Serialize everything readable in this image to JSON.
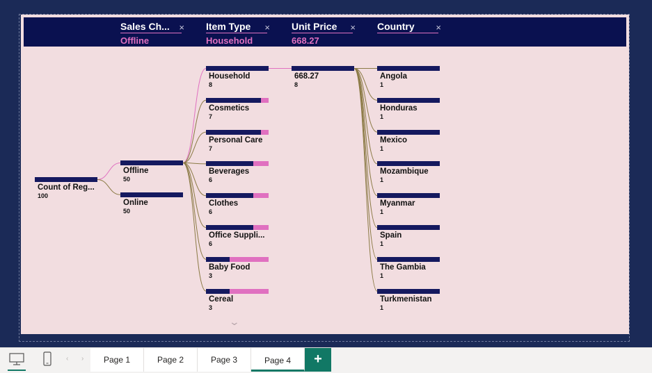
{
  "colors": {
    "canvas_bg": "#1b2a57",
    "visual_bg": "#f2dde0",
    "header_bg": "#0a1150",
    "bar_fill": "#15195f",
    "bar_remainder": "#e070c0",
    "selected_link": "#e070c0",
    "link": "#8b7a45",
    "accent_tab": "#117865"
  },
  "levels": [
    {
      "title": "Sales Ch...",
      "value": "Offline"
    },
    {
      "title": "Item Type",
      "value": "Household"
    },
    {
      "title": "Unit Price",
      "value": "668.27"
    },
    {
      "title": "Country",
      "value": ""
    }
  ],
  "remove_icon": "×",
  "root": {
    "label": "Count of Reg...",
    "count": 100
  },
  "sales_channels": [
    {
      "label": "Offline",
      "count": 50,
      "selected": true
    },
    {
      "label": "Online",
      "count": 50
    }
  ],
  "item_types": [
    {
      "label": "Household",
      "count": 8,
      "selected": true
    },
    {
      "label": "Cosmetics",
      "count": 7
    },
    {
      "label": "Personal Care",
      "count": 7
    },
    {
      "label": "Beverages",
      "count": 6
    },
    {
      "label": "Clothes",
      "count": 6
    },
    {
      "label": "Office Suppli...",
      "count": 6
    },
    {
      "label": "Baby Food",
      "count": 3
    },
    {
      "label": "Cereal",
      "count": 3
    }
  ],
  "unit_prices": [
    {
      "label": "668.27",
      "count": 8,
      "selected": true
    }
  ],
  "countries": [
    {
      "label": "Angola",
      "count": 1
    },
    {
      "label": "Honduras",
      "count": 1
    },
    {
      "label": "Mexico",
      "count": 1
    },
    {
      "label": "Mozambique",
      "count": 1
    },
    {
      "label": "Myanmar",
      "count": 1
    },
    {
      "label": "Spain",
      "count": 1
    },
    {
      "label": "The Gambia",
      "count": 1
    },
    {
      "label": "Turkmenistan",
      "count": 1
    }
  ],
  "scroll_icon": "chevron-down-icon",
  "tabbar": {
    "nav_prev": "‹",
    "nav_next": "›",
    "pages": [
      "Page 1",
      "Page 2",
      "Page 3",
      "Page 4"
    ],
    "active_page": "Page 4",
    "add_label": "+",
    "view_icons": [
      "desktop-icon",
      "mobile-icon"
    ]
  }
}
